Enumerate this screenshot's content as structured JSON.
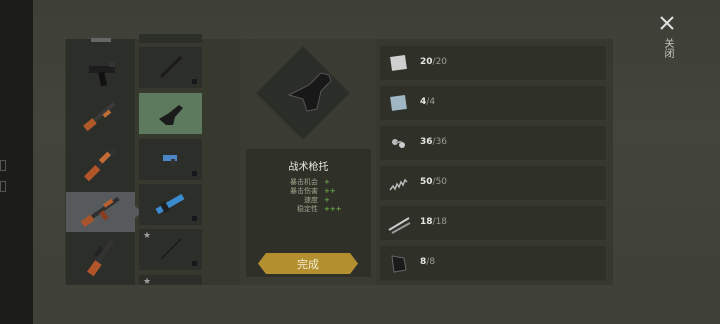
{
  "close": {
    "label": "关闭"
  },
  "part": {
    "name": "战术枪托",
    "stats": [
      {
        "label": "暴击机会",
        "value": "+"
      },
      {
        "label": "暴击伤害",
        "value": "++"
      },
      {
        "label": "速度",
        "value": "+"
      },
      {
        "label": "稳定性",
        "value": "+++"
      }
    ]
  },
  "done_button": {
    "label": "完成"
  },
  "materials": [
    {
      "icon": "metal-plate-icon",
      "count": "20",
      "max": "20"
    },
    {
      "icon": "glass-plate-icon",
      "count": "4",
      "max": "4"
    },
    {
      "icon": "bolts-icon",
      "count": "36",
      "max": "36"
    },
    {
      "icon": "spring-icon",
      "count": "50",
      "max": "50"
    },
    {
      "icon": "rods-icon",
      "count": "18",
      "max": "18"
    },
    {
      "icon": "leather-icon",
      "count": "8",
      "max": "8"
    }
  ],
  "weapons": [
    {
      "icon": "smg-icon"
    },
    {
      "icon": "shotgun-icon"
    },
    {
      "icon": "rifle-icon"
    },
    {
      "icon": "assault-rifle-icon",
      "selected": true
    },
    {
      "icon": "hunting-rifle-icon"
    }
  ],
  "parts": [
    {
      "icon": "barrel-part-icon",
      "locked": true
    },
    {
      "icon": "tactical-stock-icon",
      "selected": true
    },
    {
      "icon": "scope-part-icon",
      "locked": true
    },
    {
      "icon": "blue-mod-icon",
      "locked": true
    },
    {
      "icon": "bayonet-part-icon",
      "locked": true,
      "starred": true
    },
    {
      "icon": "part-icon",
      "starred": true
    }
  ],
  "colors": {
    "selected_part": "#5d7a5f",
    "button": "#b38f2f",
    "stat_value": "#78c44e"
  }
}
